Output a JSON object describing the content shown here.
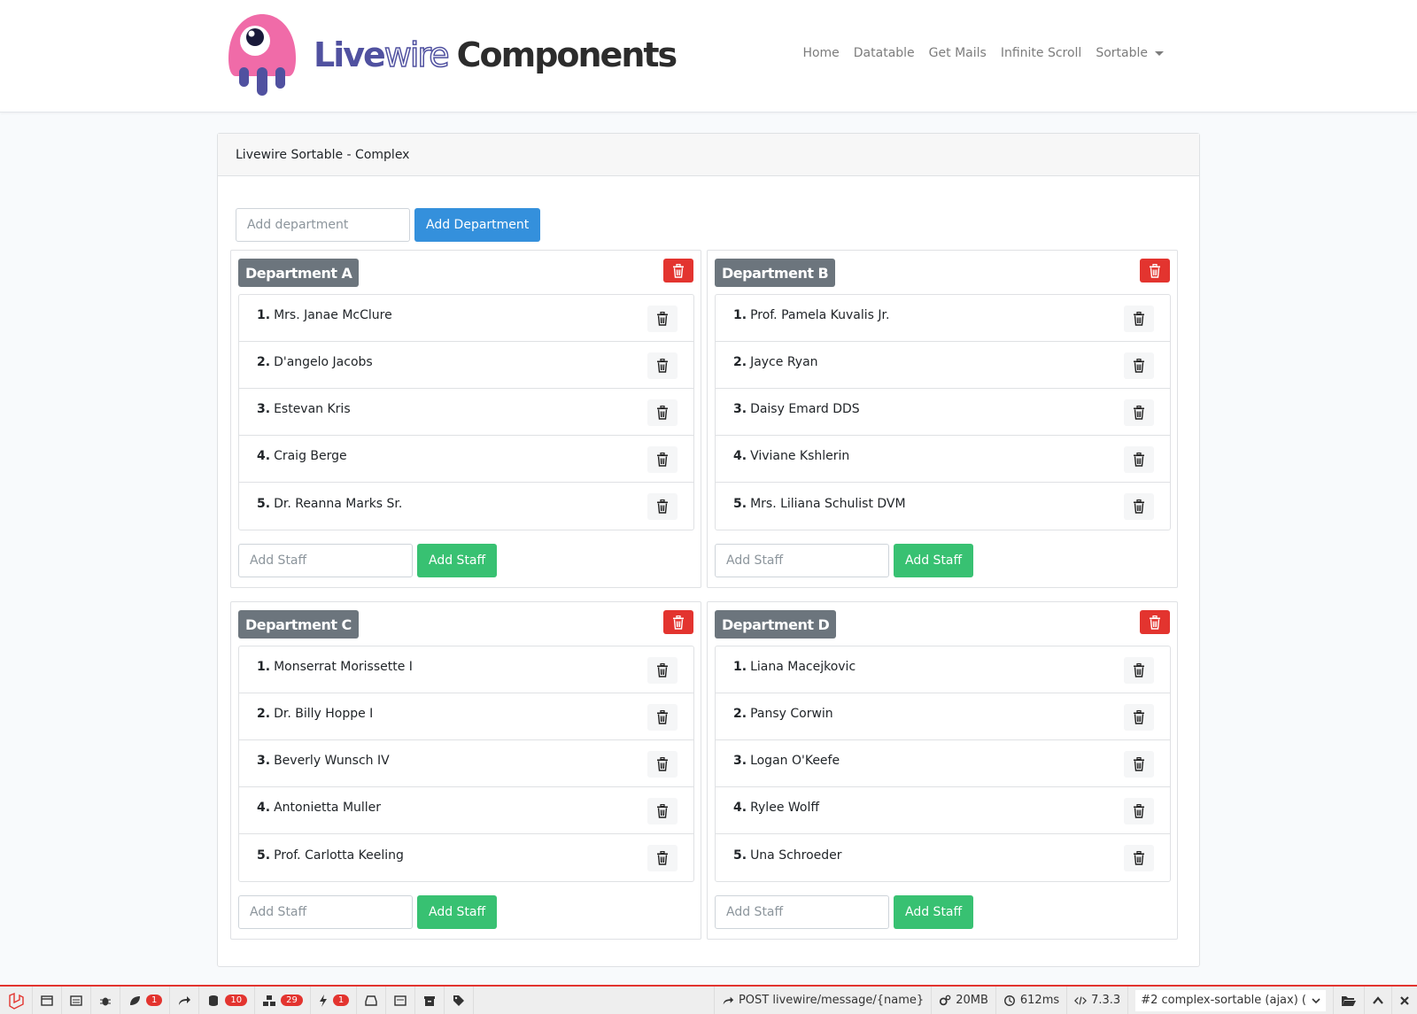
{
  "brand": {
    "word1_a": "Live",
    "word1_b": "wire",
    "word2": "Components"
  },
  "nav": {
    "items": [
      "Home",
      "Datatable",
      "Get Mails",
      "Infinite Scroll"
    ],
    "dropdown_label": "Sortable"
  },
  "card": {
    "header": "Livewire Sortable - Complex",
    "add_department_placeholder": "Add department",
    "add_department_button": "Add Department"
  },
  "departments": [
    {
      "name": "Department A",
      "staff": [
        "Mrs. Janae McClure",
        "D'angelo Jacobs",
        "Estevan Kris",
        "Craig Berge",
        "Dr. Reanna Marks Sr."
      ],
      "add_staff_placeholder": "Add Staff",
      "add_staff_button": "Add Staff"
    },
    {
      "name": "Department B",
      "staff": [
        "Prof. Pamela Kuvalis Jr.",
        "Jayce Ryan",
        "Daisy Emard DDS",
        "Viviane Kshlerin",
        "Mrs. Liliana Schulist DVM"
      ],
      "add_staff_placeholder": "Add Staff",
      "add_staff_button": "Add Staff"
    },
    {
      "name": "Department C",
      "staff": [
        "Monserrat Morissette I",
        "Dr. Billy Hoppe I",
        "Beverly Wunsch IV",
        "Antonietta Muller",
        "Prof. Carlotta Keeling"
      ],
      "add_staff_placeholder": "Add Staff",
      "add_staff_button": "Add Staff"
    },
    {
      "name": "Department D",
      "staff": [
        "Liana Macejkovic",
        "Pansy Corwin",
        "Logan O'Keefe",
        "Rylee Wolff",
        "Una Schroeder"
      ],
      "add_staff_placeholder": "Add Staff",
      "add_staff_button": "Add Staff"
    }
  ],
  "debugbar": {
    "badges": {
      "views": "1",
      "queries": "10",
      "models": "29",
      "events": "1"
    },
    "request": "POST livewire/message/{name}",
    "memory": "20MB",
    "time": "612ms",
    "php_version": "7.3.3",
    "selected_request": "#2 complex-sortable (ajax) ("
  },
  "colors": {
    "primary": "#3490dc",
    "success": "#38c172",
    "danger": "#e3342f",
    "secondary": "#6c757d",
    "brand_purple": "#5051a0",
    "logo_pink": "#f06ba8"
  }
}
